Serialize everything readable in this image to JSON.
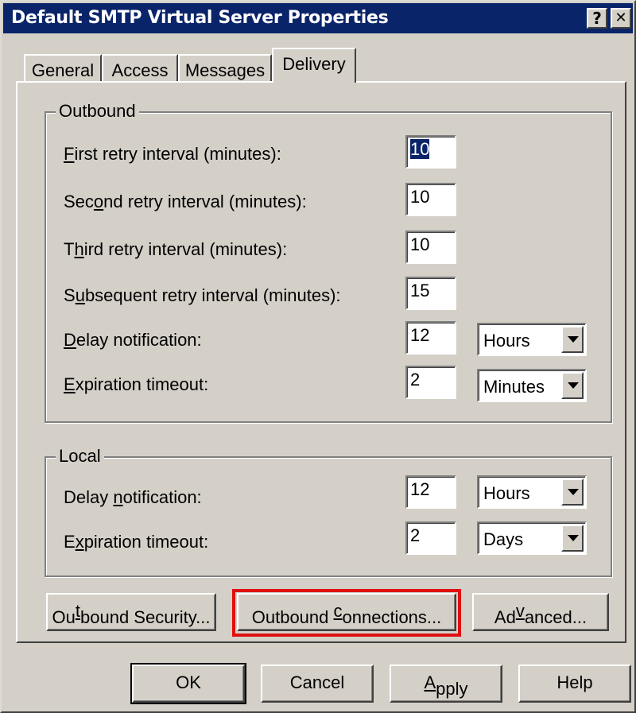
{
  "window": {
    "title": "Default SMTP Virtual Server Properties",
    "help_glyph": "?",
    "close_glyph": "✕"
  },
  "tabs": [
    {
      "label": "General"
    },
    {
      "label": "Access"
    },
    {
      "label": "Messages"
    },
    {
      "label": "Delivery",
      "active": true
    }
  ],
  "outbound": {
    "legend": "Outbound",
    "first_retry": {
      "pre": "",
      "key": "F",
      "post": "irst retry interval (minutes):",
      "value": "10"
    },
    "second_retry": {
      "pre": "Sec",
      "key": "o",
      "post": "nd retry interval (minutes):",
      "value": "10"
    },
    "third_retry": {
      "pre": "T",
      "key": "h",
      "post": "ird retry interval (minutes):",
      "value": "10"
    },
    "subsequent_retry": {
      "pre": "S",
      "key": "u",
      "post": "bsequent retry interval (minutes):",
      "value": "15"
    },
    "delay_notification": {
      "pre": "",
      "key": "D",
      "post": "elay notification:",
      "value": "12",
      "unit": "Hours"
    },
    "expiration_timeout": {
      "pre": "",
      "key": "E",
      "post": "xpiration timeout:",
      "value": "2",
      "unit": "Minutes"
    }
  },
  "local": {
    "legend": "Local",
    "delay_notification": {
      "pre": "Delay ",
      "key": "n",
      "post": "otification:",
      "value": "12",
      "unit": "Hours"
    },
    "expiration_timeout": {
      "pre": "E",
      "key": "x",
      "post": "piration timeout:",
      "value": "2",
      "unit": "Days"
    }
  },
  "action_buttons": {
    "outbound_security": {
      "pre": "Ou",
      "key": "t",
      "post": "bound Security..."
    },
    "outbound_connections": {
      "pre": "Outbound ",
      "key": "c",
      "post": "onnections..."
    },
    "advanced": {
      "pre": "Ad",
      "key": "v",
      "post": "anced..."
    }
  },
  "footer": {
    "ok": "OK",
    "cancel": "Cancel",
    "apply": {
      "pre": "",
      "key": "A",
      "post": "pply"
    },
    "help": "Help"
  },
  "colors": {
    "title_bar": "#0a246a",
    "dialog_face": "#d4d0c8",
    "highlight_box": "#e01010"
  }
}
